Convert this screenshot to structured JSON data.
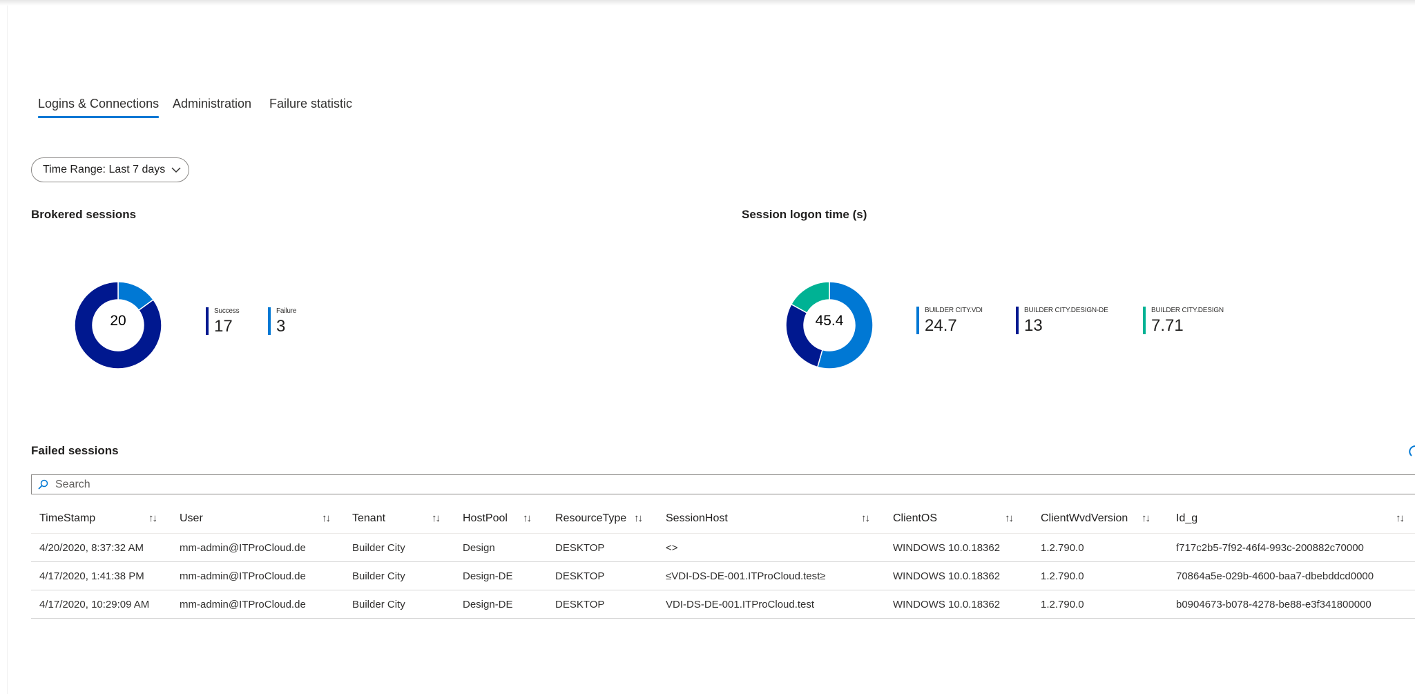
{
  "tabs": [
    {
      "label": "Logins & Connections",
      "active": true
    },
    {
      "label": "Administration",
      "active": false
    },
    {
      "label": "Failure statistic",
      "active": false
    }
  ],
  "time_range": {
    "label": "Time Range: Last 7 days",
    "icon": "chevron-down-icon"
  },
  "brokered": {
    "title": "Brokered sessions",
    "total": "20",
    "segments": [
      {
        "name": "Success",
        "value": 17,
        "display": "17",
        "color": "#00188f"
      },
      {
        "name": "Failure",
        "value": 3,
        "display": "3",
        "color": "#0078d4"
      }
    ]
  },
  "logon_time": {
    "title": "Session logon time (s)",
    "total": "45.4",
    "segments": [
      {
        "name": "BUILDER CITY.VDI",
        "value": 24.7,
        "display": "24.7",
        "color": "#0078d4"
      },
      {
        "name": "BUILDER CITY.DESIGN-DE",
        "value": 13,
        "display": "13",
        "color": "#00188f"
      },
      {
        "name": "BUILDER CITY.DESIGN",
        "value": 7.71,
        "display": "7.71",
        "color": "#00b294"
      }
    ]
  },
  "failed": {
    "title": "Failed sessions",
    "search_placeholder": "Search",
    "columns": [
      "TimeStamp",
      "User",
      "Tenant",
      "HostPool",
      "ResourceType",
      "SessionHost",
      "ClientOS",
      "ClientWvdVersion",
      "Id_g"
    ],
    "rows": [
      [
        "4/20/2020, 8:37:32 AM",
        "mm-admin@ITProCloud.de",
        "Builder City",
        "Design",
        "DESKTOP",
        "<>",
        "WINDOWS 10.0.18362",
        "1.2.790.0",
        "f717c2b5-7f92-46f4-993c-200882c70000"
      ],
      [
        "4/17/2020, 1:41:38 PM",
        "mm-admin@ITProCloud.de",
        "Builder City",
        "Design-DE",
        "DESKTOP",
        "≤VDI-DS-DE-001.ITProCloud.test≥",
        "WINDOWS 10.0.18362",
        "1.2.790.0",
        "70864a5e-029b-4600-baa7-dbebddcd0000"
      ],
      [
        "4/17/2020, 10:29:09 AM",
        "mm-admin@ITProCloud.de",
        "Builder City",
        "Design-DE",
        "DESKTOP",
        "VDI-DS-DE-001.ITProCloud.test",
        "WINDOWS 10.0.18362",
        "1.2.790.0",
        "b0904673-b078-4278-be88-e3f341800000"
      ]
    ]
  },
  "sort_glyph": "↑↓"
}
